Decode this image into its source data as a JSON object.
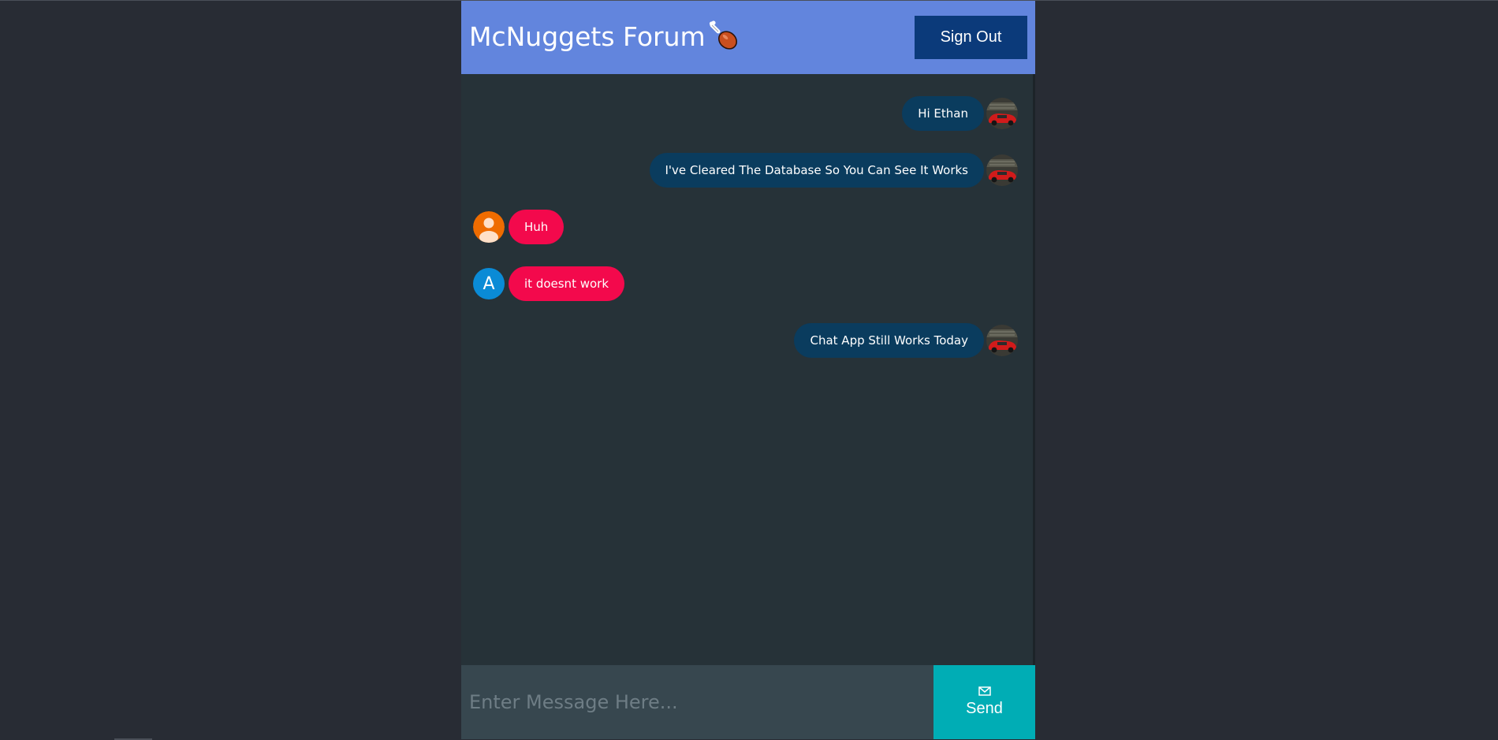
{
  "header": {
    "title": "McNuggets Forum",
    "title_icon": "drumstick-icon",
    "sign_out_label": "Sign Out"
  },
  "messages": [
    {
      "text": "Hi Ethan",
      "side": "sent",
      "avatar": "car-avatar"
    },
    {
      "text": "I've Cleared The Database So You Can See It Works",
      "side": "sent",
      "avatar": "car-avatar"
    },
    {
      "text": "Huh",
      "side": "received",
      "avatar": "person-icon"
    },
    {
      "text": "it doesnt work",
      "side": "received",
      "avatar": "A"
    },
    {
      "text": "Chat App Still Works Today",
      "side": "sent",
      "avatar": "car-avatar"
    }
  ],
  "composer": {
    "placeholder": "Enter Message Here...",
    "send_label": "Send",
    "send_icon": "mail-icon"
  },
  "colors": {
    "page_bg": "#282c34",
    "header_bg": "#6285dd",
    "sign_out_bg": "#0b3a7a",
    "chat_bg": "#263238",
    "sent_bubble": "#0a3c5e",
    "received_bubble": "#f3094c",
    "input_bg": "#37474f",
    "send_bg": "#00adb5",
    "person_avatar_bg": "#ef6c00",
    "letter_avatar_bg": "#0a8bd6"
  }
}
